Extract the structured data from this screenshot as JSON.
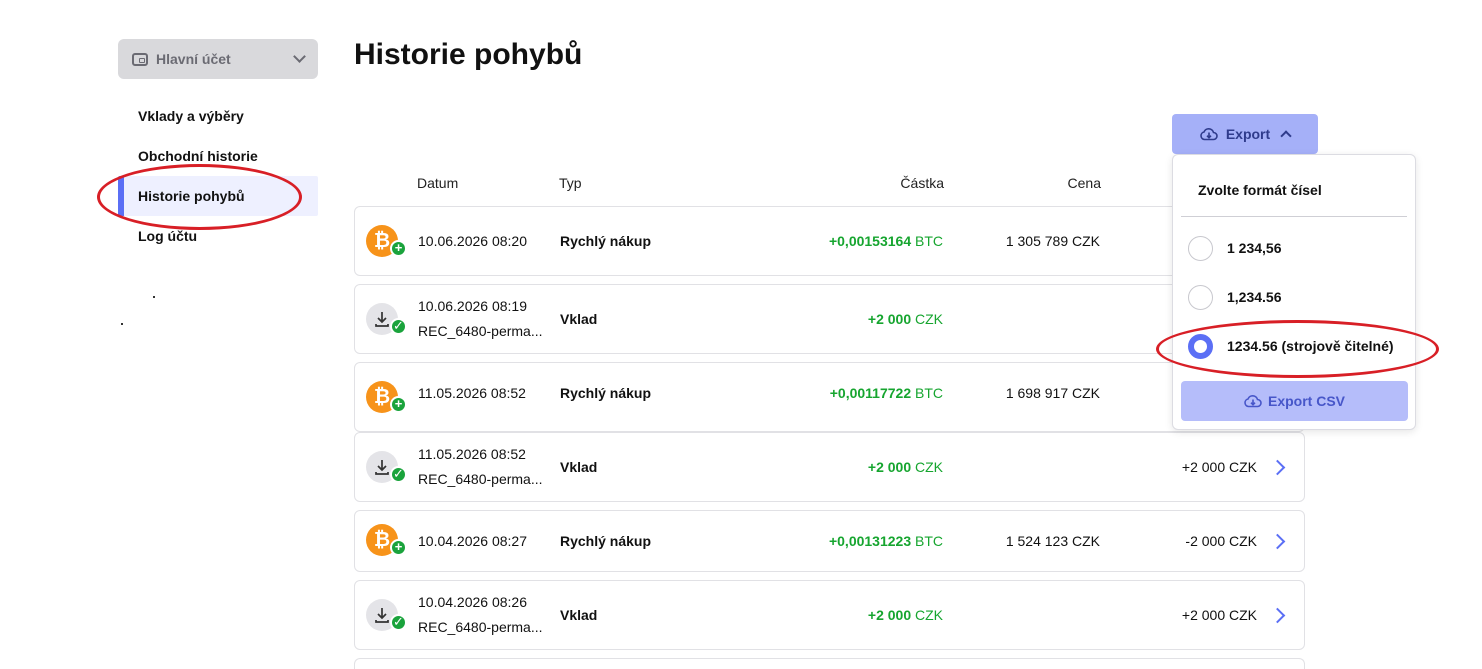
{
  "sidebar": {
    "account_label": "Hlavní účet",
    "items": [
      {
        "label": "Vklady a výběry"
      },
      {
        "label": "Obchodní historie"
      },
      {
        "label": "Historie pohybů"
      },
      {
        "label": "Log účtu"
      }
    ]
  },
  "page_title": "Historie pohybů",
  "export": {
    "button_label": "Export",
    "dropdown_title": "Zvolte formát čísel",
    "options": [
      {
        "label": "1 234,56",
        "selected": false
      },
      {
        "label": "1,234.56",
        "selected": false
      },
      {
        "label": "1234.56 (strojově čitelné)",
        "selected": true
      }
    ],
    "csv_label": "Export CSV"
  },
  "table": {
    "columns": [
      "Datum",
      "Typ",
      "Částka",
      "Cena"
    ],
    "rows": [
      {
        "icon": "bitcoin-icon",
        "date": "10.06.2026 08:20",
        "ref": "",
        "type": "Rychlý nákup",
        "amount": "+0,00153164",
        "currency": "BTC",
        "price": "1 305 789 CZK",
        "total": ""
      },
      {
        "icon": "deposit-icon",
        "date": "10.06.2026 08:19",
        "ref": "REC_6480-perma...",
        "type": "Vklad",
        "amount": "+2 000",
        "currency": "CZK",
        "price": "",
        "total": ""
      },
      {
        "icon": "bitcoin-icon",
        "date": "11.05.2026 08:52",
        "ref": "",
        "type": "Rychlý nákup",
        "amount": "+0,00117722",
        "currency": "BTC",
        "price": "1 698 917 CZK",
        "total": ""
      },
      {
        "icon": "deposit-icon",
        "date": "11.05.2026 08:52",
        "ref": "REC_6480-perma...",
        "type": "Vklad",
        "amount": "+2 000",
        "currency": "CZK",
        "price": "",
        "total": "+2 000 CZK"
      },
      {
        "icon": "bitcoin-icon",
        "date": "10.04.2026 08:27",
        "ref": "",
        "type": "Rychlý nákup",
        "amount": "+0,00131223",
        "currency": "BTC",
        "price": "1 524 123 CZK",
        "total": "-2 000 CZK"
      },
      {
        "icon": "deposit-icon",
        "date": "10.04.2026 08:26",
        "ref": "REC_6480-perma...",
        "type": "Vklad",
        "amount": "+2 000",
        "currency": "CZK",
        "price": "",
        "total": "+2 000 CZK"
      }
    ]
  },
  "colors": {
    "accent": "#5b6ff5",
    "positive": "#16a52f",
    "bitcoin": "#f7931a",
    "annotation": "#d81f26"
  }
}
